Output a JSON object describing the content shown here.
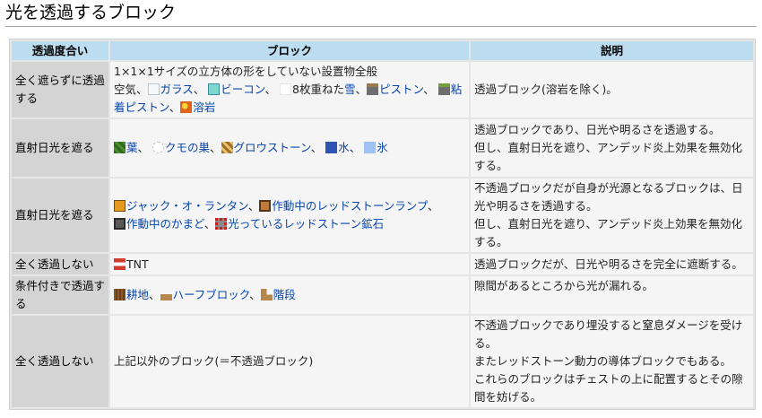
{
  "page": {
    "title": "光を透過するブロック"
  },
  "table": {
    "headers": {
      "level": "透過度合い",
      "block": "ブロック",
      "desc": "説明"
    },
    "rows": [
      {
        "level": "全く遮らずに透過する",
        "block": {
          "line1": "1×1×1サイズの立方体の形をしていない設置物全般",
          "air": "空気、",
          "glass": "ガラス",
          "sep1": "、",
          "beacon": "ビーコン",
          "sep2": "、",
          "snow_prefix": "8枚重ねた",
          "snow": "雪",
          "sep3": "、",
          "piston": "ピストン",
          "sep4": "、",
          "sticky": "粘着ピストン",
          "sep5": "、",
          "lava": "溶岩"
        },
        "desc": "透過ブロック(溶岩を除く)。"
      },
      {
        "level": "直射日光を遮る",
        "block": {
          "leaves": "葉",
          "sep1": "、",
          "web": "クモの巣",
          "sep2": "、",
          "glowstone": "グロウストーン",
          "sep3": "、",
          "water": "水",
          "sep4": "、",
          "ice": "氷"
        },
        "desc": [
          "透過ブロックであり、日光や明るさを透過する。",
          "但し、直射日光を遮り、アンデッド炎上効果を無効化する。"
        ]
      },
      {
        "level": "直射日光を遮る",
        "block": {
          "jack": "ジャック・オ・ランタン",
          "sep1": "、",
          "lamp": "作動中のレッドストーンランプ",
          "sep2": "、",
          "furnace": "作動中のかまど",
          "sep3": "、",
          "ore": "光っているレッドストーン鉱石"
        },
        "desc": [
          "不透過ブロックだが自身が光源となるブロックは、日光や明るさを透過する。",
          "但し、直射日光を遮り、アンデッド炎上効果を無効化する。"
        ]
      },
      {
        "level": "全く透過しない",
        "block": {
          "tnt": "TNT"
        },
        "desc": "透過ブロックだが、日光や明るさを完全に遮断する。"
      },
      {
        "level": "条件付きで透過する",
        "block": {
          "farmland": "耕地",
          "sep1": "、",
          "slab": "ハーフブロック",
          "sep2": "、",
          "stairs": "階段"
        },
        "desc": "隙間があるところから光が漏れる。"
      },
      {
        "level": "全く透過しない",
        "block": {
          "text": "上記以外のブロック(＝不透過ブロック)"
        },
        "desc": [
          "不透過ブロックであり埋没すると窒息ダメージを受ける。",
          "またレッドストーン動力の導体ブロックでもある。",
          "これらのブロックはチェストの上に配置するとその隙間を妨げる。"
        ]
      }
    ]
  },
  "icons": [
    "glass-icon",
    "beacon-icon",
    "snow-icon",
    "piston-icon",
    "sticky-piston-icon",
    "lava-icon",
    "leaves-icon",
    "cobweb-icon",
    "glowstone-icon",
    "water-icon",
    "ice-icon",
    "jack-o-lantern-icon",
    "redstone-lamp-icon",
    "furnace-icon",
    "redstone-ore-icon",
    "tnt-icon",
    "farmland-icon",
    "slab-icon",
    "stairs-icon"
  ],
  "colors": {
    "header_bg": "#bcdcf0",
    "rowhead_bg": "#d4d4d4",
    "cell_bg": "#f5f5f5",
    "link": "#0645ad"
  }
}
